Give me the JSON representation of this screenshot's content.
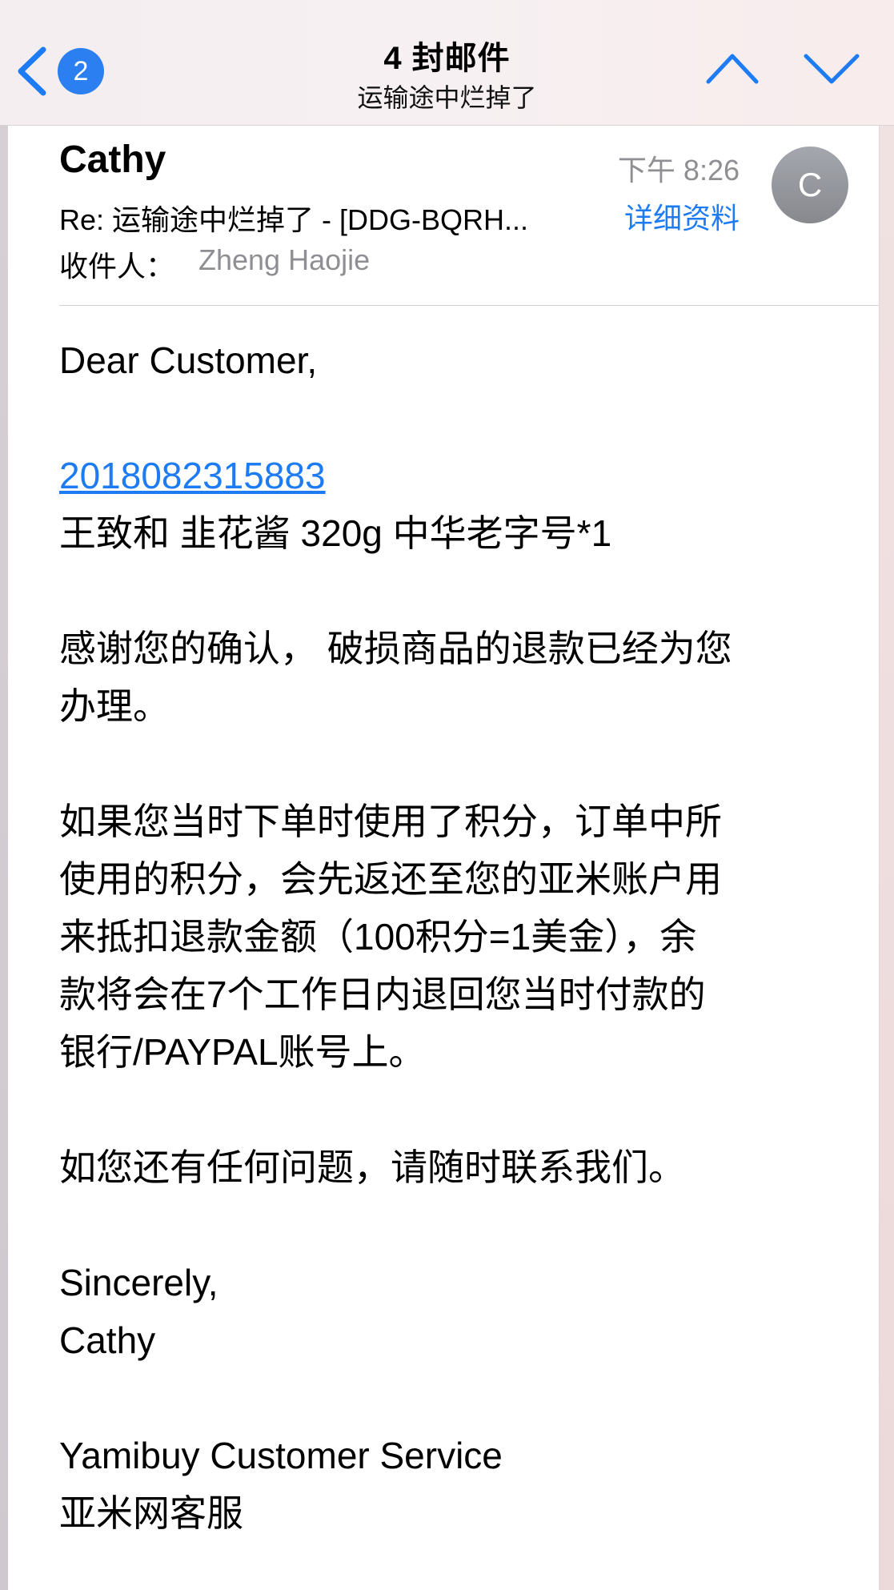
{
  "navbar": {
    "badge_count": "2",
    "title": "4 封邮件",
    "subtitle": "运输途中烂掉了",
    "accent_color": "#1d7bf4"
  },
  "header": {
    "sender": "Cathy",
    "time": "下午 8:26",
    "subject": "Re: 运输途中烂掉了 - [DDG-BQRH...",
    "details_label": "详细资料",
    "avatar_initial": "C",
    "recipient_label": "收件人：",
    "recipient": "Zheng Haojie"
  },
  "body": {
    "greeting": "Dear Customer,",
    "order_number": "2018082315883",
    "item_line": "王致和 韭花酱 320g 中华老字号*1",
    "para1_lines": [
      "感谢您的确认， 破损商品的退款已经为您",
      "办理。"
    ],
    "para2_lines": [
      "如果您当时下单时使用了积分，订单中所",
      "使用的积分，会先返还至您的亚米账户用",
      "来抵扣退款金额（100积分=1美金），余",
      "款将会在7个工作日内退回您当时付款的",
      "银行/PAYPAL账号上。"
    ],
    "para3": "如您还有任何问题，请随时联系我们。",
    "closing": "Sincerely,",
    "signature_name": "Cathy",
    "company_en": "Yamibuy Customer Service",
    "company_cn": "亚米网客服"
  }
}
